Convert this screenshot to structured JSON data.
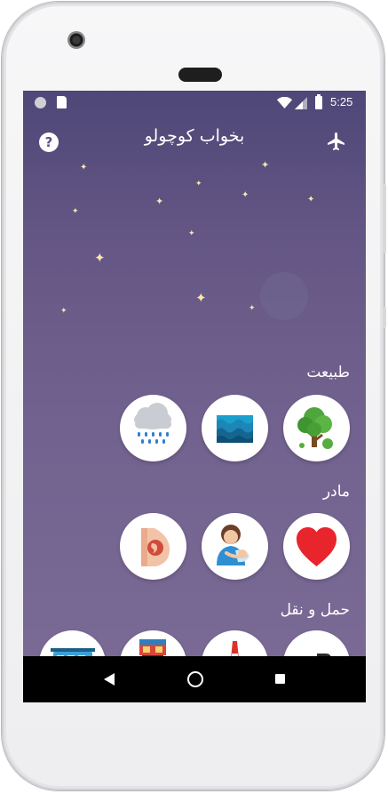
{
  "status_bar": {
    "time": "5:25"
  },
  "header": {
    "title": "بخواب کوچولو",
    "help_label": "?"
  },
  "sections": [
    {
      "title": "طبیعت",
      "items": [
        "cloud-rain-icon",
        "water-waves-icon",
        "tree-icon"
      ]
    },
    {
      "title": "مادر",
      "items": [
        "pregnant-belly-icon",
        "mother-baby-icon",
        "heart-icon"
      ]
    },
    {
      "title": "حمل و نقل",
      "items": [
        "bus-icon",
        "train-icon",
        "airplane-icon",
        "car-icon"
      ]
    }
  ],
  "colors": {
    "background_top": "#4e4777",
    "background_bottom": "#7b6b96",
    "star": "#f8e7a6",
    "heart": "#e8242d"
  },
  "star_glyph": "✦"
}
